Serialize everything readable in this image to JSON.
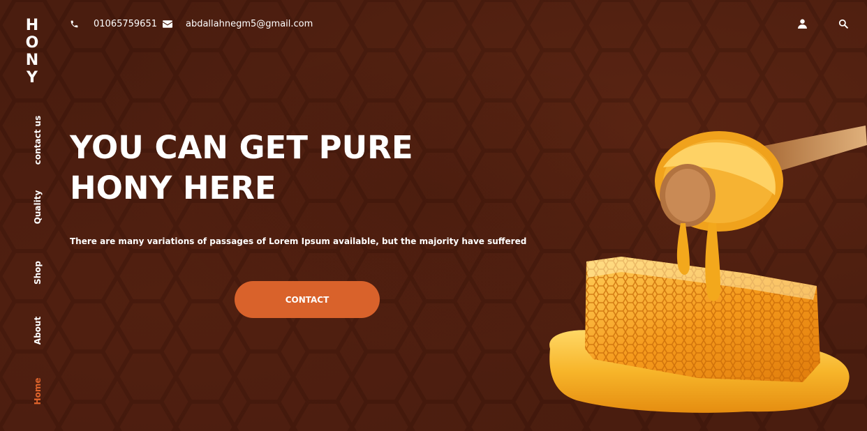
{
  "brand": {
    "letters": [
      "H",
      "O",
      "N",
      "Y"
    ]
  },
  "nav": {
    "items": [
      {
        "label": "contact us",
        "active": false
      },
      {
        "label": "Quality",
        "active": false
      },
      {
        "label": "Shop",
        "active": false
      },
      {
        "label": "About",
        "active": false
      },
      {
        "label": "Home",
        "active": true
      }
    ]
  },
  "topbar": {
    "phone_icon": "phone-icon",
    "phone": "01065759651",
    "email_icon": "envelope-icon",
    "email": "abdallahnegm5@gmail.com",
    "user_icon": "user-icon",
    "search_icon": "search-icon"
  },
  "hero": {
    "title_line1": "YOU CAN GET PURE",
    "title_line2": "HONY HERE",
    "subtitle": "There are many variations of passages of Lorem Ipsum available, but the majority have suffered",
    "cta_label": "CONTACT"
  },
  "colors": {
    "background": "#4a1d0f",
    "accent": "#d9622b",
    "active_nav": "#e0642c",
    "text": "#ffffff"
  }
}
